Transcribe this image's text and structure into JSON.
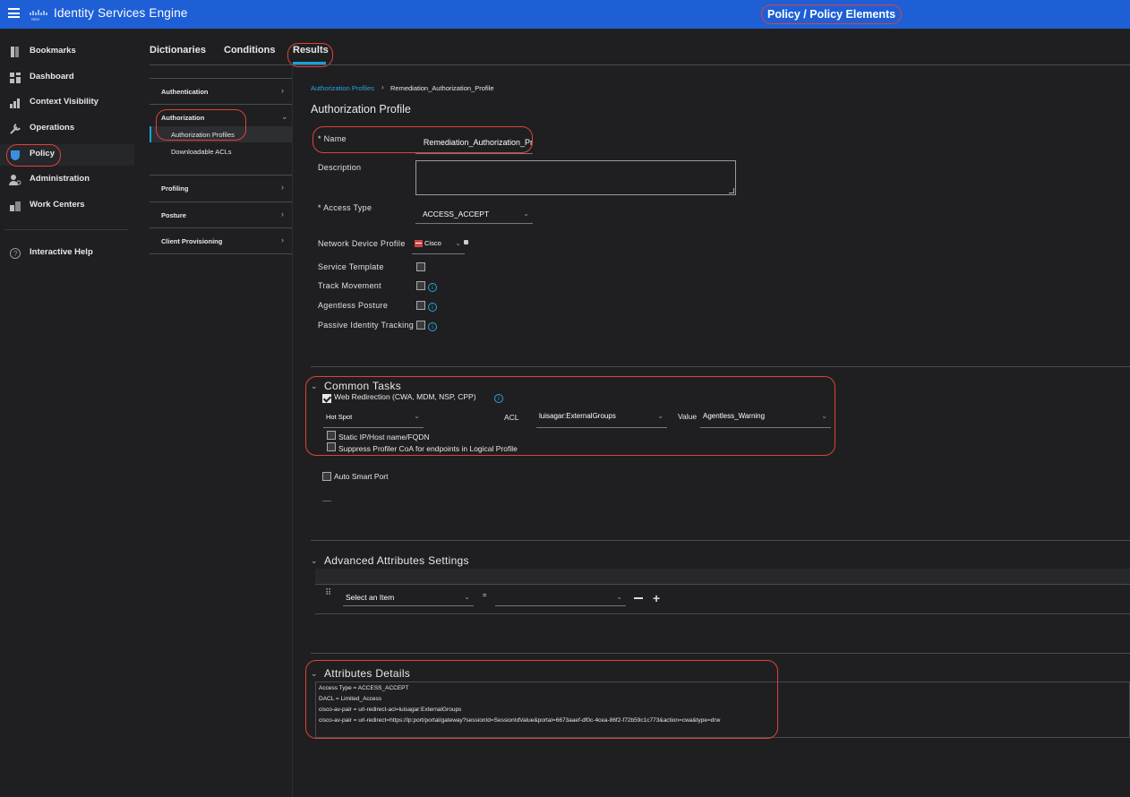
{
  "header": {
    "app_title": "Identity Services Engine",
    "page_path": "Policy / Policy Elements"
  },
  "nav": {
    "items": [
      {
        "label": "Bookmarks",
        "icon": "bookmark-icon"
      },
      {
        "label": "Dashboard",
        "icon": "dashboard-icon"
      },
      {
        "label": "Context Visibility",
        "icon": "context-visibility-icon"
      },
      {
        "label": "Operations",
        "icon": "operations-icon"
      },
      {
        "label": "Policy",
        "icon": "policy-icon"
      },
      {
        "label": "Administration",
        "icon": "administration-icon"
      },
      {
        "label": "Work Centers",
        "icon": "work-centers-icon"
      }
    ],
    "help": {
      "label": "Interactive Help",
      "icon": "help-icon"
    }
  },
  "tabs": [
    "Dictionaries",
    "Conditions",
    "Results"
  ],
  "sidemenu": {
    "authentication": "Authentication",
    "authorization": "Authorization",
    "authorization_profiles": "Authorization Profiles",
    "downloadable_acls": "Downloadable ACLs",
    "profiling": "Profiling",
    "posture": "Posture",
    "client_provisioning": "Client Provisioning"
  },
  "breadcrumb": {
    "link": "Authorization Profiles",
    "current": "Remediation_Authorization_Profile"
  },
  "form": {
    "title": "Authorization Profile",
    "name_label": "* Name",
    "name_value": "Remediation_Authorization_Pr",
    "description_label": "Description",
    "access_type_label": "* Access Type",
    "access_type_value": "ACCESS_ACCEPT",
    "ndp_label": "Network Device Profile",
    "ndp_value": "Cisco",
    "service_template_label": "Service Template",
    "track_movement_label": "Track Movement",
    "agentless_posture_label": "Agentless Posture",
    "passive_identity_label": "Passive Identity Tracking",
    "info_glyph": "i"
  },
  "common_tasks": {
    "title": "Common Tasks",
    "web_redirection_label": "Web Redirection (CWA, MDM, NSP, CPP)",
    "web_redirection_checked": true,
    "redirect_type": "Hot Spot",
    "acl_label": "ACL",
    "acl_value": "luisagar:ExternalGroups",
    "value_label": "Value",
    "value_value": "Agentless_Warning",
    "static_ip_label": "Static IP/Host name/FQDN",
    "suppress_label": "Suppress Profiler CoA for endpoints in Logical Profile",
    "auto_smart_port_label": "Auto Smart Port"
  },
  "advanced": {
    "title": "Advanced Attributes Settings",
    "select_placeholder": "Select an Item",
    "equals": "="
  },
  "attributes_details": {
    "title": "Attributes Details",
    "lines": [
      "Access Type = ACCESS_ACCEPT",
      "DACL = Limited_Access",
      "cisco-av-pair = url-redirect-acl=luisagar:ExternalGroups",
      "cisco-av-pair = url-redirect=https://ip:port/portal/gateway?sessionId=SessionIdValue&portal=6673aaef-df0c-4cea-86f2-f72b59c1c773&action=cwa&type=drw"
    ]
  },
  "colors": {
    "topbar": "#1e5fd6",
    "accent": "#17a2d6",
    "highlight_circle": "#e0413a",
    "background": "#1f1f21"
  }
}
